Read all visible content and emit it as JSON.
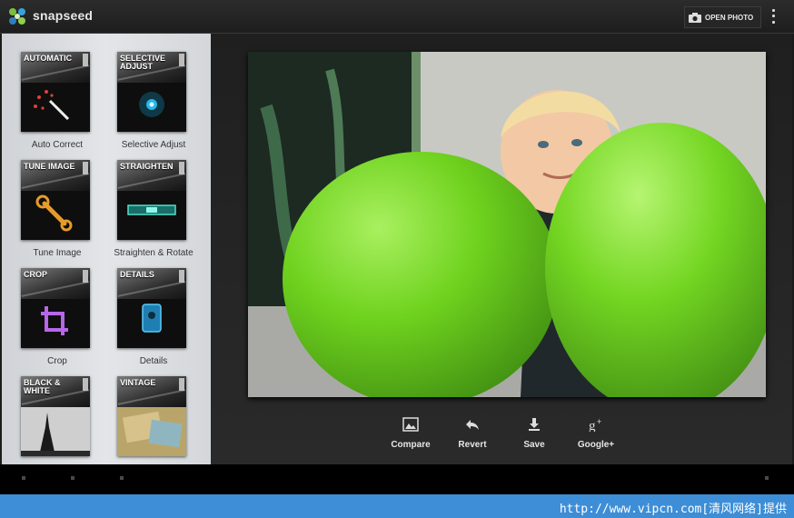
{
  "app": {
    "title": "snapseed"
  },
  "toolbar": {
    "open_photo_label": "OPEN PHOTO"
  },
  "tools": [
    {
      "tile": "AUTOMATIC",
      "label": "Auto Correct",
      "icon": "magic-wand-icon"
    },
    {
      "tile": "SELECTIVE ADJUST",
      "label": "Selective Adjust",
      "icon": "control-point-icon"
    },
    {
      "tile": "TUNE IMAGE",
      "label": "Tune Image",
      "icon": "wrench-icon"
    },
    {
      "tile": "STRAIGHTEN",
      "label": "Straighten & Rotate",
      "icon": "level-icon"
    },
    {
      "tile": "CROP",
      "label": "Crop",
      "icon": "crop-icon"
    },
    {
      "tile": "DETAILS",
      "label": "Details",
      "icon": "sharpener-icon"
    },
    {
      "tile": "BLACK & WHITE",
      "label": "",
      "icon": "eiffel-tower-thumbnail"
    },
    {
      "tile": "VINTAGE",
      "label": "",
      "icon": "vintage-thumbnail"
    }
  ],
  "actions": [
    {
      "label": "Compare",
      "icon": "image-icon"
    },
    {
      "label": "Revert",
      "icon": "undo-icon"
    },
    {
      "label": "Save",
      "icon": "download-icon"
    },
    {
      "label": "Google+",
      "icon": "google-plus-icon"
    }
  ],
  "watermark": "http://www.vipcn.com[清风网络]提供",
  "colors": {
    "balloon": "#6fd21e",
    "topbar": "#242424",
    "watermark_bar": "#3d8ed6"
  }
}
